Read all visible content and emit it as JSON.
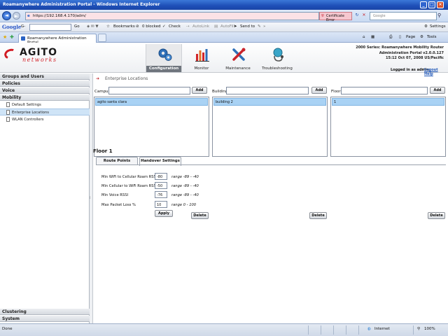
{
  "browser": {
    "title": "Roamanywhere Administration Portal - Windows Internet Explorer",
    "url": "https://192.168.4.170/adm/",
    "cert_error": "Certificate Error",
    "search_placeholder": "Google",
    "toolbar": {
      "google": "Google",
      "g_dropdown": "G-",
      "go": "Go",
      "bookmarks": "Bookmarks",
      "blocked": "0 blocked",
      "check": "Check",
      "autolink": "AutoLink",
      "autofill": "AutoFill",
      "send_to": "Send to",
      "settings": "Settings"
    },
    "tab_label": "Roamanywhere Administration Portal",
    "commands": {
      "page": "Page",
      "tools": "Tools"
    },
    "status": {
      "left": "Done",
      "zone": "Internet",
      "zoom": "100%"
    }
  },
  "app": {
    "logo_top": "AGITO",
    "logo_bottom": "networks",
    "nav": [
      {
        "label": "Configuration",
        "icon": "gears-icon",
        "active": true
      },
      {
        "label": "Monitor",
        "icon": "bar-chart-icon",
        "active": false
      },
      {
        "label": "Maintenance",
        "icon": "tools-icon",
        "active": false
      },
      {
        "label": "Troubleshooting",
        "icon": "stethoscope-icon",
        "active": false
      }
    ],
    "product_info": {
      "line1": "2000 Series: Roamanywhere Mobility Router",
      "line2": "Administration Portal  v2.0.0.127",
      "line3": "15:12 Oct 07, 2008 US/Pacific"
    },
    "logged_in": "Logged in as admin",
    "logout": "Logout  Help"
  },
  "sidebar": {
    "groups_top": [
      "Groups and Users",
      "Policies",
      "Voice",
      "Mobility"
    ],
    "items": [
      {
        "label": "Default Settings",
        "selected": false
      },
      {
        "label": "Enterprise Locations",
        "selected": true
      },
      {
        "label": "WLAN Controllers",
        "selected": false
      }
    ],
    "groups_bottom": [
      "Clustering",
      "System"
    ]
  },
  "main": {
    "section_title": "Enterprise Locations",
    "campus": {
      "label": "Campus",
      "add": "Add",
      "selected": "agito santa clara",
      "delete": "Delete"
    },
    "building": {
      "label": "Building",
      "add": "Add",
      "selected": "building 2",
      "delete": "Delete"
    },
    "floor": {
      "label": "Floor",
      "add": "Add",
      "selected": "1",
      "delete": "Delete"
    },
    "floor_title": "Floor 1",
    "tabs": [
      "Route Points",
      "Handover Settings"
    ],
    "settings": [
      {
        "label": "Min WiFi to Cellular Roam RSSI",
        "value": "-80",
        "range": "range -89 - -40"
      },
      {
        "label": "Min Cellular to WiFi Roam RSSI",
        "value": "-50",
        "range": "range -89 - -40"
      },
      {
        "label": "Min Voice RSSI",
        "value": "-76",
        "range": "range -89 - -40"
      },
      {
        "label": "Max Packet Loss %",
        "value": "10",
        "range": "range 0 - 100"
      }
    ],
    "apply": "Apply"
  }
}
